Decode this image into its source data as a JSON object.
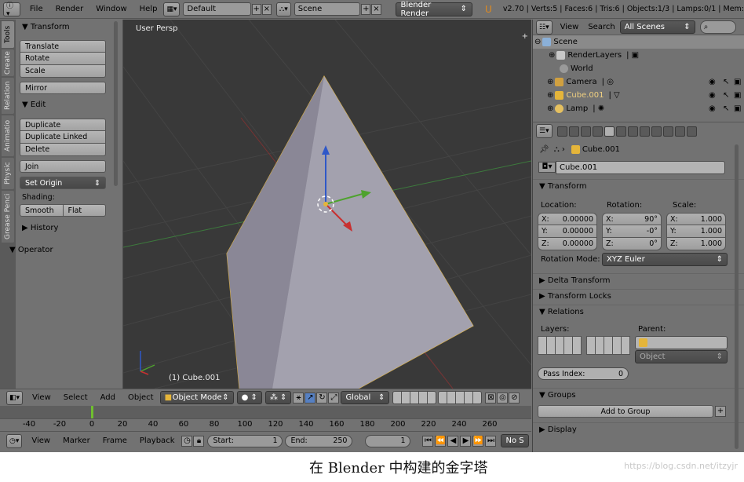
{
  "topbar": {
    "menus": [
      "File",
      "Render",
      "Window",
      "Help"
    ],
    "screen_layout": "Default",
    "scene": "Scene",
    "engine": "Blender Render",
    "stats": "v2.70 | Verts:5 | Faces:6 | Tris:6 | Objects:1/3 | Lamps:0/1 | Mem:"
  },
  "tool_tabs": [
    "Tools",
    "Create",
    "Relation",
    "Animatio",
    "Physic",
    "Grease Penci"
  ],
  "tool_shelf": {
    "transform": {
      "header": "Transform",
      "buttons": [
        "Translate",
        "Rotate",
        "Scale"
      ],
      "mirror": "Mirror"
    },
    "edit": {
      "header": "Edit",
      "buttons": [
        "Duplicate",
        "Duplicate Linked",
        "Delete"
      ],
      "join": "Join",
      "set_origin": "Set Origin"
    },
    "shading": {
      "label": "Shading:",
      "smooth": "Smooth",
      "flat": "Flat"
    },
    "history": "History",
    "operator": "Operator"
  },
  "viewport": {
    "view_label": "User Persp",
    "object_label": "(1) Cube.001"
  },
  "viewport_header": {
    "menus": [
      "View",
      "Select",
      "Add",
      "Object"
    ],
    "mode": "Object Mode",
    "orientation": "Global"
  },
  "timeline": {
    "ruler": [
      "-40",
      "-20",
      "0",
      "20",
      "40",
      "60",
      "80",
      "100",
      "120",
      "140",
      "160",
      "180",
      "200",
      "220",
      "240",
      "260"
    ],
    "menus": [
      "View",
      "Marker",
      "Frame",
      "Playback"
    ],
    "start_label": "Start:",
    "start": "1",
    "end_label": "End:",
    "end": "250",
    "current": "1",
    "sync": "No S"
  },
  "outliner": {
    "menus": [
      "View",
      "Search"
    ],
    "filter": "All Scenes",
    "rows": [
      "Scene",
      "RenderLayers",
      "World",
      "Camera",
      "Cube.001",
      "Lamp"
    ]
  },
  "properties": {
    "object_path": "Cube.001",
    "object_name": "Cube.001",
    "transform_header": "Transform",
    "location_label": "Location:",
    "rotation_label": "Rotation:",
    "scale_label": "Scale:",
    "location": [
      [
        "X:",
        "0.00000"
      ],
      [
        "Y:",
        "0.00000"
      ],
      [
        "Z:",
        "0.00000"
      ]
    ],
    "rotation": [
      [
        "X:",
        "90°"
      ],
      [
        "Y:",
        "-0°"
      ],
      [
        "Z:",
        "0°"
      ]
    ],
    "scale": [
      [
        "X:",
        "1.000"
      ],
      [
        "Y:",
        "1.000"
      ],
      [
        "Z:",
        "1.000"
      ]
    ],
    "rotation_mode_label": "Rotation Mode:",
    "rotation_mode": "XYZ Euler",
    "delta_transform": "Delta Transform",
    "transform_locks": "Transform Locks",
    "relations": "Relations",
    "layers_label": "Layers:",
    "parent_label": "Parent:",
    "parent_type": "Object",
    "pass_index_label": "Pass Index:",
    "pass_index": "0",
    "groups": "Groups",
    "add_to_group": "Add to Group",
    "display": "Display"
  },
  "caption": "在 Blender 中构建的金字塔",
  "watermark": "https://blog.csdn.net/itzyjr"
}
